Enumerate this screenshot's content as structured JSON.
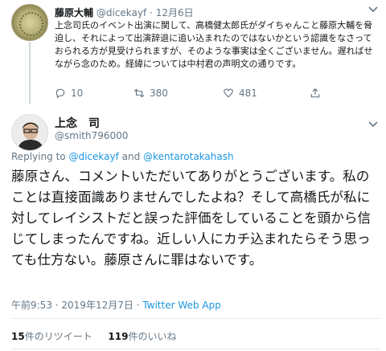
{
  "parent_tweet": {
    "display_name": "藤原大輔",
    "handle": "@dicekayf",
    "separator": "·",
    "date": "12月6日",
    "text": "上念司氏のイベント出演に関して、高橋健太郎氏がダイちゃんこと藤原大輔を脅迫し、それによって出演辞退に追い込まれたのではないかという認識をなさっておられる方が見受けられますが、そのような事実は全くございません。遅ればせながら念のため。経緯については中村君の声明文の通りです。",
    "replies": "10",
    "retweets": "380",
    "likes": "481"
  },
  "reply_tweet": {
    "display_name": "上念　司",
    "handle": "@smith796000",
    "replying_prefix": "Replying to ",
    "mention_1": "@dicekayf",
    "and": " and ",
    "mention_2": "@kentarotakahash",
    "text": "藤原さん、コメントいただいてありがとうございます。私のことは直接面識ありませんでしたよね？そして高橋氏が私に対してレイシストだと誤った評価をしていることを頭から信じてしまったんですね。近しい人にカチ込まれたらそう思っても仕方ない。藤原さんに罪はないです。",
    "time": "午前9:53",
    "meta_sep": " · ",
    "date": "2019年12月7日",
    "source": "Twitter Web App",
    "retweet_count": "15",
    "retweet_label": "件のリツイート",
    "like_count": "119",
    "like_label": "件のいいね"
  },
  "icons": {
    "chevron": "chevron-down-icon",
    "reply": "reply-icon",
    "retweet": "retweet-icon",
    "like": "heart-icon"
  },
  "colors": {
    "link": "#1b95e0",
    "secondary": "#657786"
  }
}
